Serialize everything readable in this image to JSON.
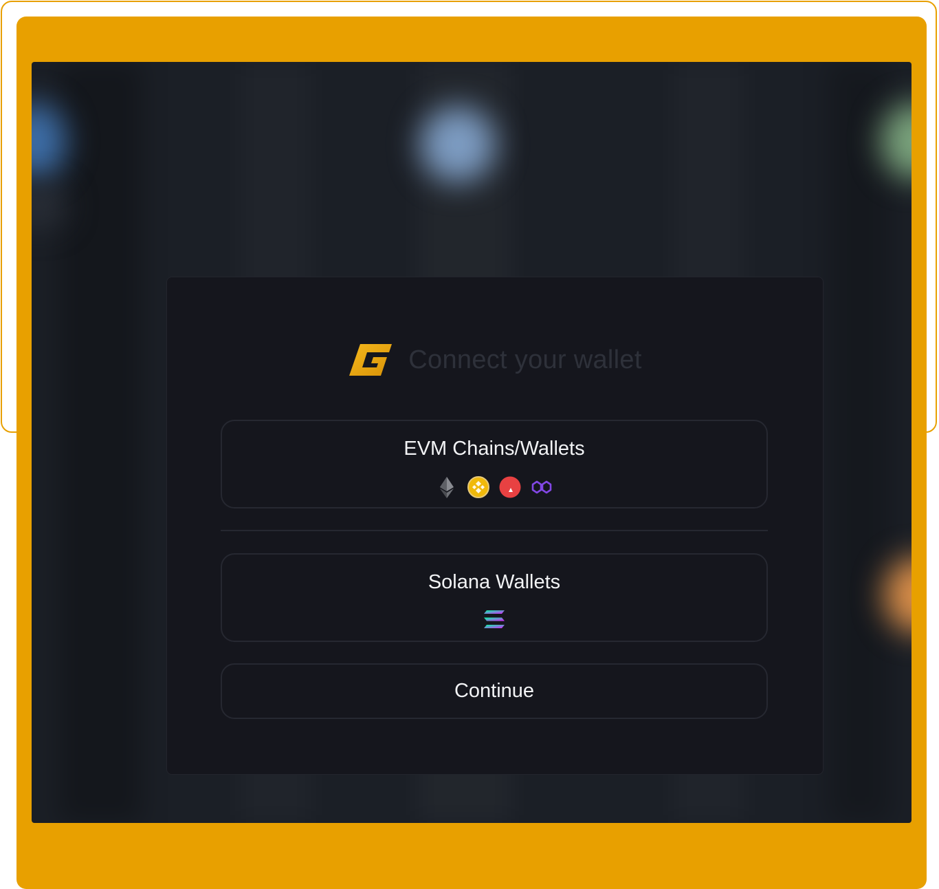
{
  "modal": {
    "title": "Connect your wallet",
    "options": [
      {
        "label": "EVM Chains/Wallets",
        "icons": [
          "ethereum-icon",
          "bnb-icon",
          "avalanche-icon",
          "polygon-icon"
        ]
      },
      {
        "label": "Solana Wallets",
        "icons": [
          "solana-icon"
        ]
      }
    ],
    "continue_label": "Continue"
  },
  "colors": {
    "accent": "#E8A000",
    "modal_bg": "#15161d",
    "border": "#262831",
    "text": "#f2f3f5",
    "title_dim": "#2e313a"
  }
}
